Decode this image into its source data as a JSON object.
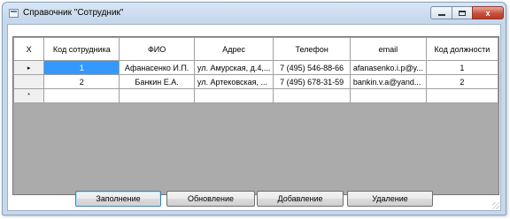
{
  "window": {
    "title": "Справочник \"Сотрудник\"",
    "controls": {
      "minimize": "",
      "maximize": "",
      "close": "x"
    }
  },
  "grid": {
    "columns": [
      "X",
      "Код сотрудника",
      "ФИО",
      "Адрес",
      "Телефон",
      "email",
      "Код должности"
    ],
    "rows": [
      {
        "marker": "▸",
        "id": "1",
        "fio": "Афанасенко И.П.",
        "address": "ул. Амурская, д.4,...",
        "phone": "7 (495) 546-88-66",
        "email": "afanasenko.i.p@y...",
        "position": "1"
      },
      {
        "marker": "",
        "id": "2",
        "fio": "Банкин Е.А.",
        "address": "ул. Артековская, ...",
        "phone": "7 (495) 678-31-59",
        "email": "bankin.v.a@yand...",
        "position": "2"
      },
      {
        "marker": "*",
        "id": "",
        "fio": "",
        "address": "",
        "phone": "",
        "email": "",
        "position": ""
      }
    ]
  },
  "buttons": {
    "fill": "Заполнение",
    "refresh": "Обновление",
    "add": "Добавление",
    "delete": "Удаление"
  }
}
